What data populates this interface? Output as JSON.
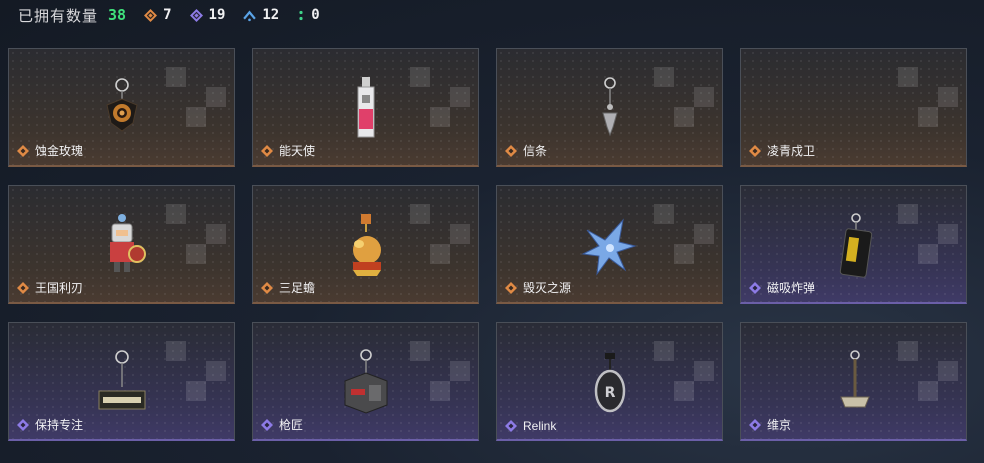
{
  "header": {
    "owned_label": "已拥有数量",
    "owned_count": "38",
    "stats": [
      {
        "icon": "orange-diamond-icon",
        "color": "#e08a45",
        "value": "7"
      },
      {
        "icon": "purple-diamond-icon",
        "color": "#8d7be6",
        "value": "19"
      },
      {
        "icon": "blue-chevron-icon",
        "color": "#5aa3e8",
        "value": "12"
      },
      {
        "icon": "green-dots-icon",
        "color": "#3fd48a",
        "value": "0"
      }
    ]
  },
  "rarity_colors": {
    "orange": "#e08a45",
    "purple": "#8d7be6"
  },
  "charms": [
    {
      "name": "蚀金玫瑰",
      "rarity": "orange",
      "icon": "rose-charm-icon"
    },
    {
      "name": "能天使",
      "rarity": "orange",
      "icon": "bottle-charm-icon"
    },
    {
      "name": "信条",
      "rarity": "orange",
      "icon": "skull-pendant-charm-icon"
    },
    {
      "name": "凌青戍卫",
      "rarity": "orange",
      "icon": "empty-charm-icon"
    },
    {
      "name": "王国利刃",
      "rarity": "orange",
      "icon": "knight-charm-icon"
    },
    {
      "name": "三足蟾",
      "rarity": "orange",
      "icon": "toad-charm-icon"
    },
    {
      "name": "毁灭之源",
      "rarity": "orange",
      "icon": "dragon-charm-icon"
    },
    {
      "name": "磁吸炸弹",
      "rarity": "purple",
      "icon": "bomb-charm-icon"
    },
    {
      "name": "保持专注",
      "rarity": "purple",
      "icon": "sign-charm-icon"
    },
    {
      "name": "枪匠",
      "rarity": "purple",
      "icon": "toolbox-charm-icon"
    },
    {
      "name": "Relink",
      "rarity": "purple",
      "icon": "mask-charm-icon"
    },
    {
      "name": "维京",
      "rarity": "purple",
      "icon": "hammer-charm-icon"
    }
  ]
}
